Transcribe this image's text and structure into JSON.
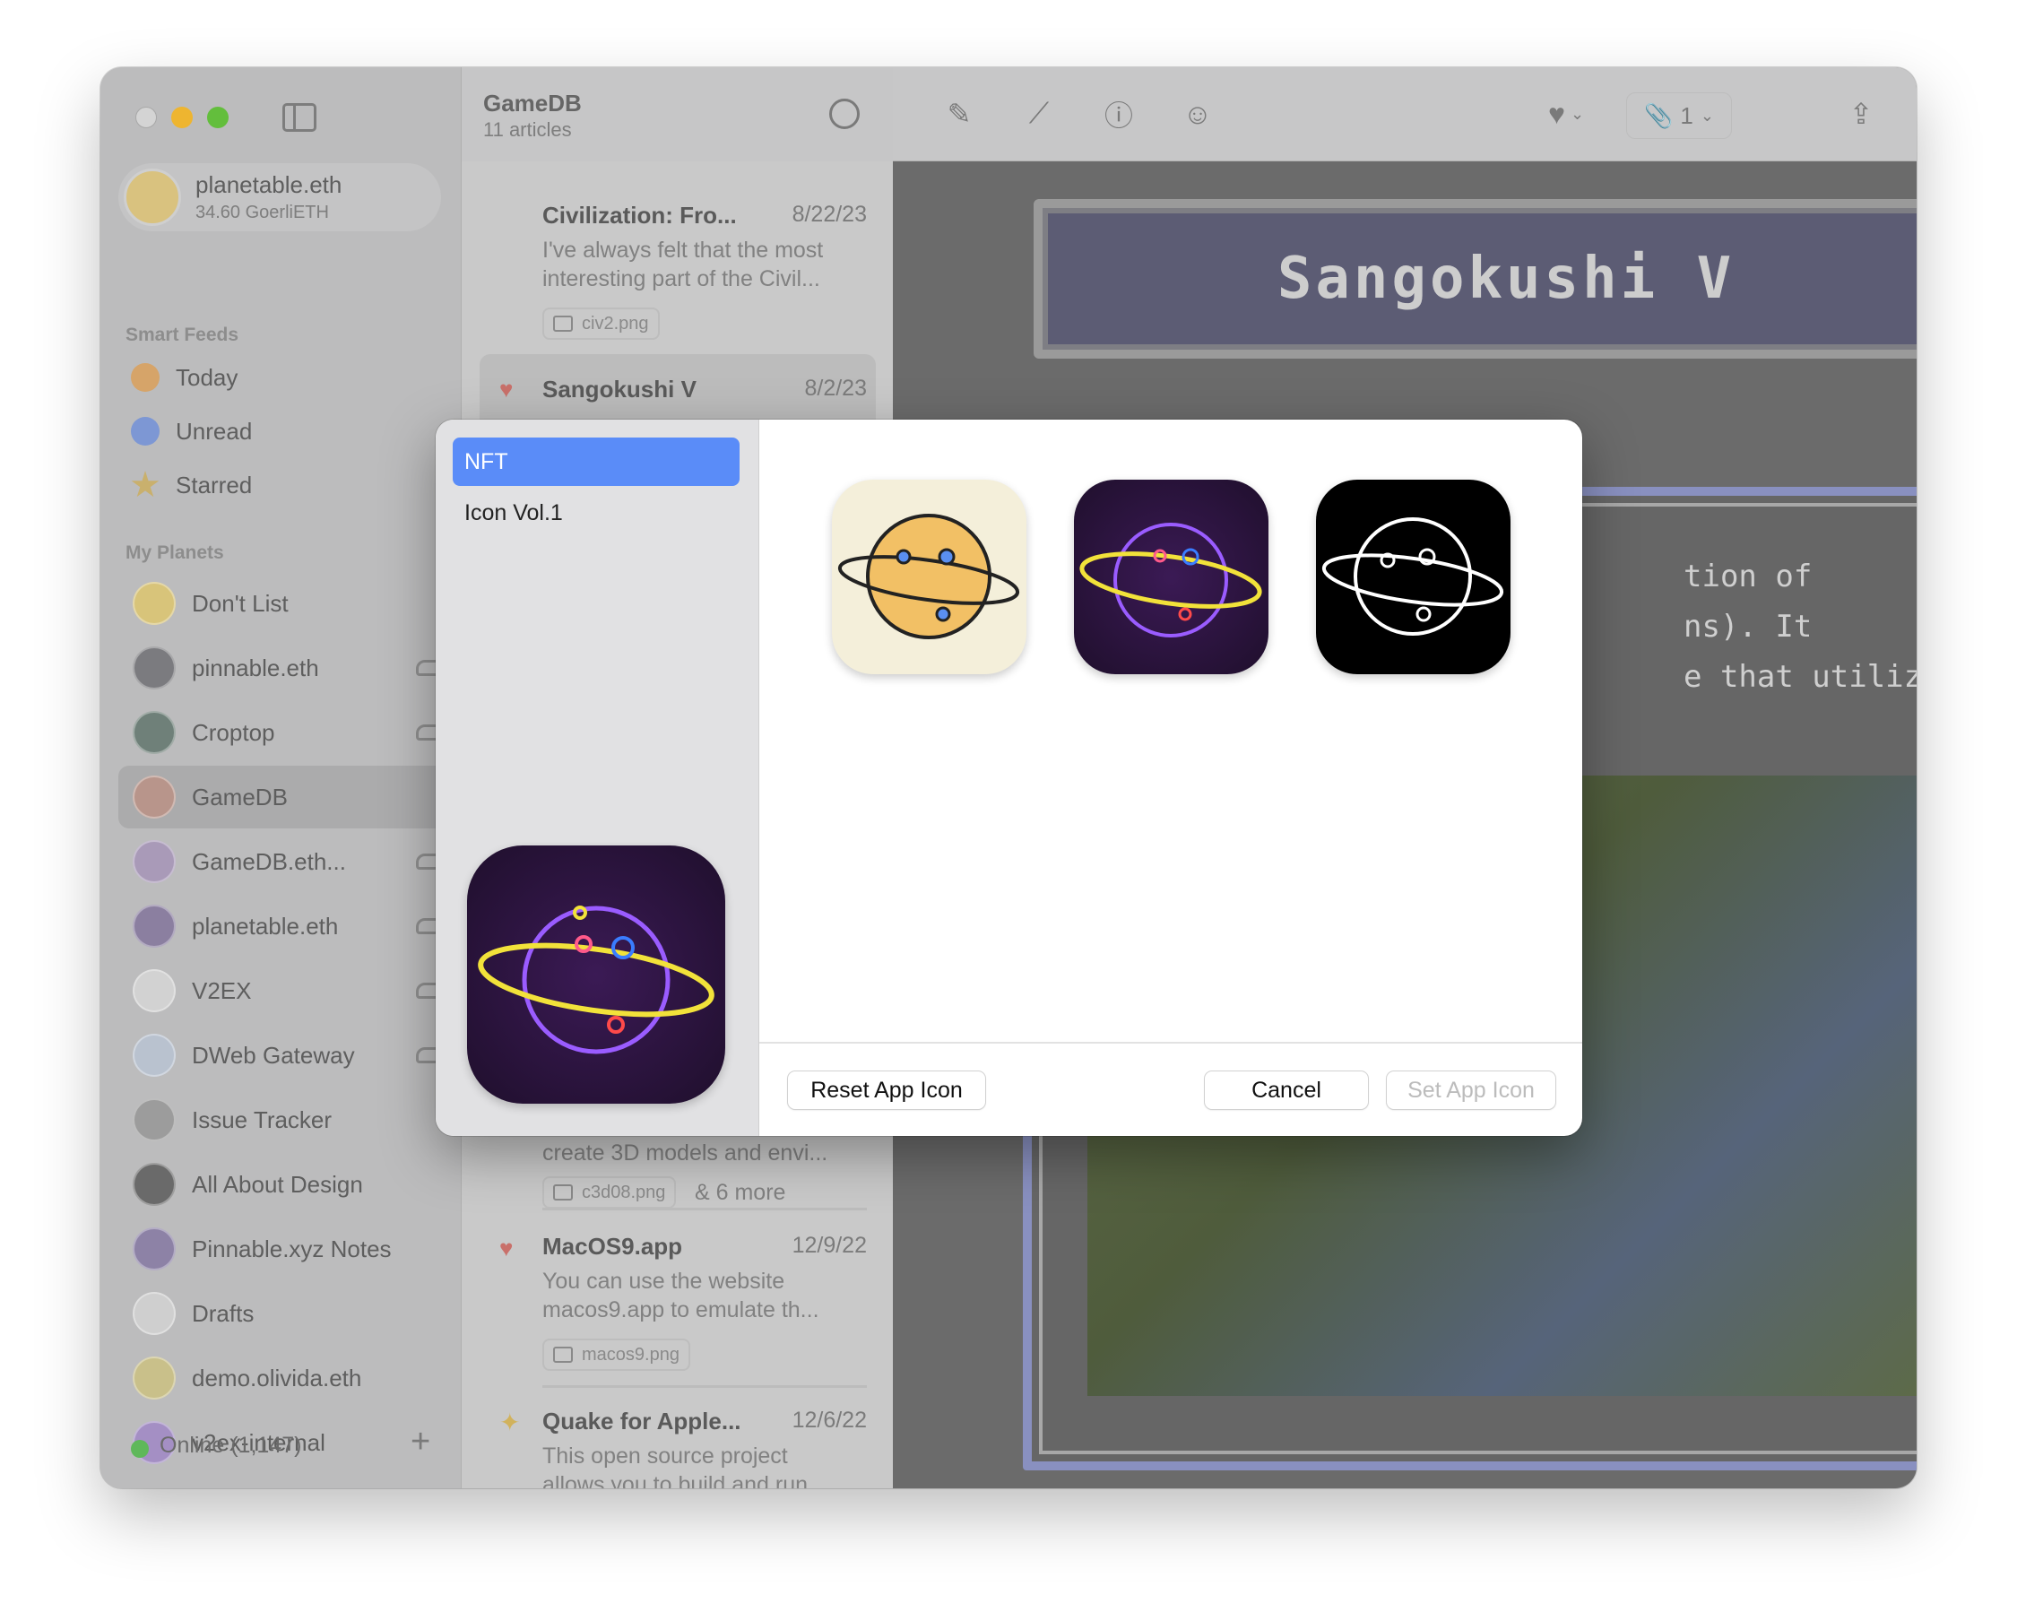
{
  "account": {
    "name": "planetable.eth",
    "balance": "34.60 GoerliETH"
  },
  "sidebar": {
    "smart_feeds_label": "Smart Feeds",
    "smart_feeds": [
      {
        "label": "Today",
        "icon": "sun-icon",
        "color": "#d6a469"
      },
      {
        "label": "Unread",
        "icon": "unread-circle-icon",
        "color": "#7d97d4"
      },
      {
        "label": "Starred",
        "icon": "star-icon",
        "color": "#c9b06d"
      }
    ],
    "my_planets_label": "My Planets",
    "planets": [
      {
        "label": "Don't List",
        "color": "#d8c47a",
        "shared": false
      },
      {
        "label": "pinnable.eth",
        "color": "#7b7b7f",
        "shared": true
      },
      {
        "label": "Croptop",
        "color": "#6f8079",
        "shared": true
      },
      {
        "label": "GameDB",
        "color": "#b8958b",
        "shared": false,
        "selected": true
      },
      {
        "label": "GameDB.eth...",
        "color": "#a99ab8",
        "shared": true
      },
      {
        "label": "planetable.eth",
        "color": "#8b7fa0",
        "shared": true
      },
      {
        "label": "V2EX",
        "color": "#d2d2d2",
        "shared": true
      },
      {
        "label": "DWeb Gateway",
        "color": "#b9c2cf",
        "shared": true
      },
      {
        "label": "Issue Tracker",
        "color": "#9c9c9c",
        "shared": false
      },
      {
        "label": "All About Design",
        "color": "#6a6a6a",
        "shared": false
      },
      {
        "label": "Pinnable.xyz Notes",
        "color": "#8d82a6",
        "shared": false
      },
      {
        "label": "Drafts",
        "color": "#cfcfcf",
        "shared": false
      },
      {
        "label": "demo.olivida.eth",
        "color": "#c9c08a",
        "shared": false
      },
      {
        "label": "v2ex-internal",
        "color": "#a48fc4",
        "shared": false
      }
    ],
    "status": "Online (1,147)",
    "add_label": "+"
  },
  "list": {
    "title": "GameDB",
    "count": "11 articles",
    "articles_top": [
      {
        "title": "Civilization: Fro...",
        "date": "8/22/23",
        "lines": [
          "I've always felt that the most",
          "interesting part of the Civil..."
        ],
        "tag": "civ2.png"
      },
      {
        "title": "Sangokushi V",
        "date": "8/2/23",
        "starred": true
      }
    ],
    "partial_body": "create 3D models and envi...",
    "partial_tag": "c3d08.png",
    "partial_more": "& 6 more",
    "articles_bottom": [
      {
        "title": "MacOS9.app",
        "date": "12/9/22",
        "lines": [
          "You can use the website",
          "macos9.app to emulate th..."
        ],
        "tag": "macos9.png",
        "mark": "heart"
      },
      {
        "title": "Quake for Apple...",
        "date": "12/6/22",
        "lines": [
          "This open source project",
          "allows you to build and run"
        ],
        "mark": "sparkle"
      }
    ]
  },
  "toolbar": {
    "attachment_count": "1"
  },
  "article": {
    "banner_title": "Sangokushi V",
    "text_lines": [
      "tion of",
      "ns). It",
      "e that utilizes a"
    ]
  },
  "dialog": {
    "categories": [
      {
        "label": "NFT",
        "selected": true
      },
      {
        "label": "Icon Vol.1"
      }
    ],
    "icons": [
      "planet-classic-icon",
      "planet-neon-icon",
      "planet-glitch-icon"
    ],
    "reset_label": "Reset App Icon",
    "cancel_label": "Cancel",
    "set_label": "Set App Icon"
  }
}
